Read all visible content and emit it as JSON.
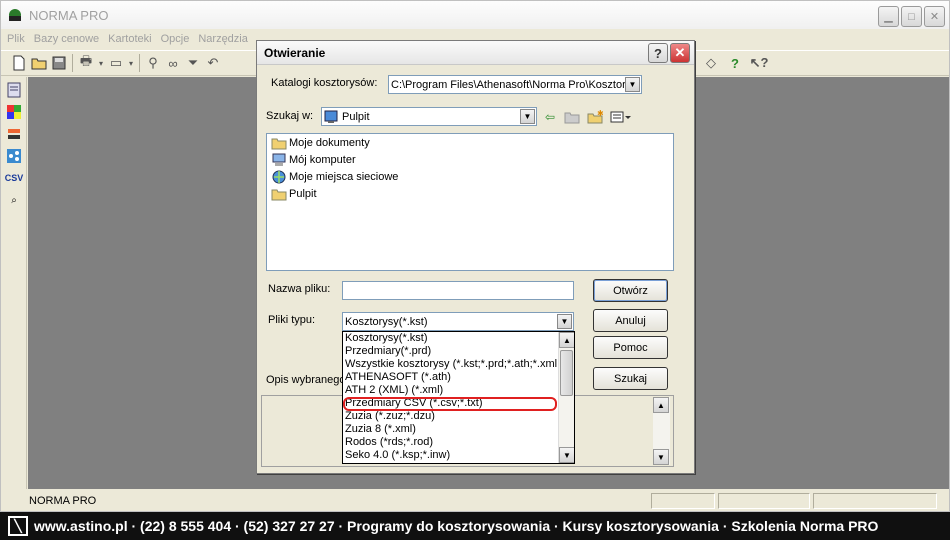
{
  "app": {
    "title": "NORMA PRO",
    "menu": [
      "Plik",
      "Bazy cenowe",
      "Kartoteki",
      "Opcje",
      "Narzędzia"
    ],
    "status": "NORMA PRO"
  },
  "dialog": {
    "title": "Otwieranie",
    "catalog_label": "Katalogi kosztorysów:",
    "catalog_value": "C:\\Program Files\\Athenasoft\\Norma Pro\\Kosztorys",
    "lookin_label": "Szukaj w:",
    "lookin_value": "Pulpit",
    "files": [
      {
        "name": "Moje dokumenty",
        "icon": "folder-documents-icon"
      },
      {
        "name": "Mój komputer",
        "icon": "computer-icon"
      },
      {
        "name": "Moje miejsca sieciowe",
        "icon": "network-places-icon"
      },
      {
        "name": "Pulpit",
        "icon": "folder-icon"
      }
    ],
    "filename_label": "Nazwa pliku:",
    "filename_value": "",
    "filetype_label": "Pliki typu:",
    "filetype_value": "Kosztorysy(*.kst)",
    "description_label": "Opis wybranego",
    "buttons": {
      "open": "Otwórz",
      "cancel": "Anuluj",
      "help": "Pomoc",
      "search": "Szukaj"
    },
    "filetype_options": [
      "Kosztorysy(*.kst)",
      "Przedmiary(*.prd)",
      "Wszystkie kosztorysy (*.kst;*.prd;*.ath;*.xml;*.",
      "ATHENASOFT (*.ath)",
      "ATH 2 (XML) (*.xml)",
      "Przedmiary CSV (*.csv;*.txt)",
      "Zuzia (*.zuz;*.dzu)",
      "Zuzia 8 (*.xml)",
      "Rodos (*rds;*.rod)",
      "Seko 4.0 (*.ksp;*.inw)"
    ],
    "highlighted_option": "Przedmiary CSV (*.csv;*.txt)"
  },
  "banner": {
    "text": "www.astino.pl · (22) 8 555 404 · (52) 327 27 27 · Programy do kosztorysowania · Kursy kosztorysowania · Szkolenia Norma PRO"
  },
  "colors": {
    "highlight_ring": "#e02020",
    "banner_bg": "#101010",
    "workspace": "#808080"
  }
}
